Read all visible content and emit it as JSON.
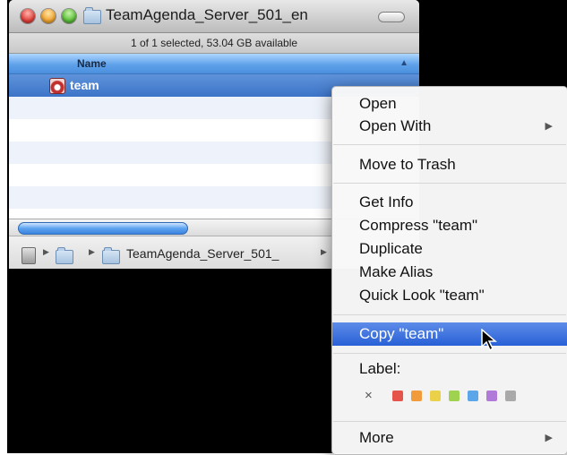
{
  "window": {
    "title": "TeamAgenda_Server_501_en",
    "status": "1 of 1 selected, 53.04 GB available",
    "column_header": "Name",
    "selected_item": "team",
    "path_last": "TeamAgenda_Server_501_"
  },
  "context_menu": {
    "open": "Open",
    "open_with": "Open With",
    "move_to_trash": "Move to Trash",
    "get_info": "Get Info",
    "compress": "Compress \"team\"",
    "duplicate": "Duplicate",
    "make_alias": "Make Alias",
    "quick_look": "Quick Look \"team\"",
    "copy": "Copy \"team\"",
    "label_heading": "Label:",
    "label_none": "×",
    "more": "More",
    "submenu_arrow": "▶",
    "label_colors": [
      "#e5534b",
      "#f29b3a",
      "#ebd14a",
      "#9fd24f",
      "#5aa6e8",
      "#b17ad9",
      "#a9a9a9"
    ]
  }
}
